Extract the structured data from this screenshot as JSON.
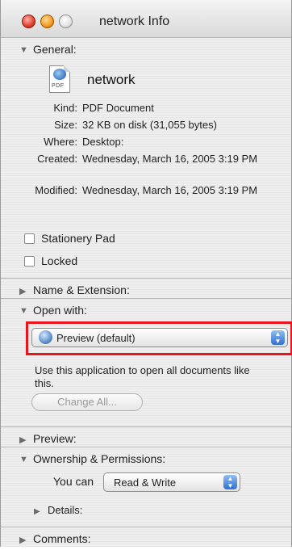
{
  "window": {
    "title": "network Info"
  },
  "general": {
    "header": "General:",
    "file_name": "network",
    "icon_badge": "PDF",
    "fields": [
      {
        "key": "Kind:",
        "value": "PDF Document"
      },
      {
        "key": "Size:",
        "value": "32 KB on disk (31,055 bytes)"
      },
      {
        "key": "Where:",
        "value": "Desktop:"
      },
      {
        "key": "Created:",
        "value": "Wednesday, March 16, 2005 3:19 PM"
      },
      {
        "key": "Modified:",
        "value": "Wednesday, March 16, 2005 3:19 PM"
      }
    ],
    "checkboxes": [
      {
        "label": "Stationery Pad",
        "checked": false
      },
      {
        "label": "Locked",
        "checked": false
      }
    ]
  },
  "name_extension": {
    "header": "Name & Extension:"
  },
  "open_with": {
    "header": "Open with:",
    "selected_app": "Preview (default)",
    "note": "Use this application to open all documents like this.",
    "change_all_label": "Change All..."
  },
  "preview": {
    "header": "Preview:"
  },
  "ownership": {
    "header": "Ownership & Permissions:",
    "you_can_label": "You can",
    "permission_value": "Read & Write",
    "details_label": "Details:"
  },
  "comments": {
    "header": "Comments:"
  },
  "colors": {
    "highlight": "#e8151d",
    "popup_arrows": "#2f6fd0"
  }
}
